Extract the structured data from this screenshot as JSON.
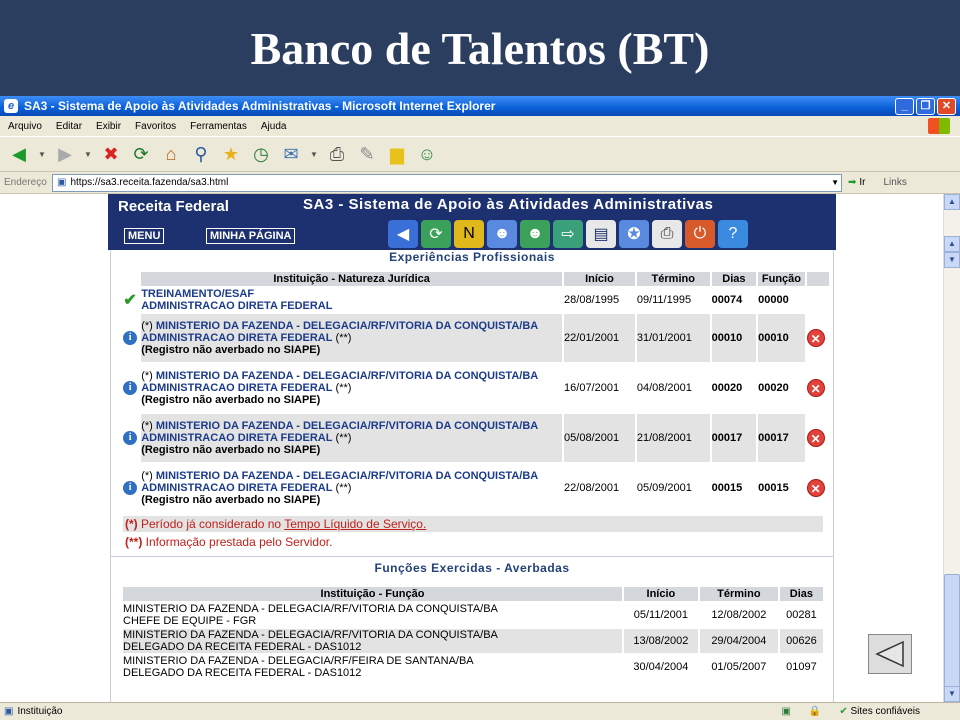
{
  "slide": {
    "title": "Banco de Talentos (BT)"
  },
  "window": {
    "title": "SA3 - Sistema de Apoio às Atividades Administrativas - Microsoft Internet Explorer"
  },
  "menu": [
    "Arquivo",
    "Editar",
    "Exibir",
    "Favoritos",
    "Ferramentas",
    "Ajuda"
  ],
  "address": {
    "label": "Endereço",
    "url": "https://sa3.receita.fazenda/sa3.html",
    "go": "Ir",
    "links": "Links"
  },
  "app": {
    "org": "Receita Federal",
    "system": "SA3 - Sistema de Apoio às Atividades Administrativas",
    "menu_label": "MENU",
    "my_page_label": "MINHA PÁGINA"
  },
  "exp": {
    "title": "Experiências Profissionais",
    "headers": [
      "Instituição - Natureza Jurídica",
      "Início",
      "Término",
      "Dias",
      "Função"
    ],
    "rows": [
      {
        "inst": "TREINAMENTO/ESAF",
        "nature": "ADMINISTRACAO DIRETA FEDERAL",
        "prefix": "",
        "nature_suffix": "",
        "note": "",
        "start": "28/08/1995",
        "end": "09/11/1995",
        "days": "00074",
        "func": "00000"
      },
      {
        "prefix": "(*) ",
        "inst": "MINISTERIO DA FAZENDA - DELEGACIA/RF/VITORIA DA CONQUISTA/BA",
        "nature": "ADMINISTRACAO DIRETA FEDERAL",
        "nature_suffix": " (**)",
        "note": "(Registro não averbado no SIAPE)",
        "start": "22/01/2001",
        "end": "31/01/2001",
        "days": "00010",
        "func": "00010"
      },
      {
        "prefix": "(*) ",
        "inst": "MINISTERIO DA FAZENDA - DELEGACIA/RF/VITORIA DA CONQUISTA/BA",
        "nature": "ADMINISTRACAO DIRETA FEDERAL",
        "nature_suffix": " (**)",
        "note": "(Registro não averbado no SIAPE)",
        "start": "16/07/2001",
        "end": "04/08/2001",
        "days": "00020",
        "func": "00020"
      },
      {
        "prefix": "(*) ",
        "inst": "MINISTERIO DA FAZENDA - DELEGACIA/RF/VITORIA DA CONQUISTA/BA",
        "nature": "ADMINISTRACAO DIRETA FEDERAL",
        "nature_suffix": " (**)",
        "note": "(Registro não averbado no SIAPE)",
        "start": "05/08/2001",
        "end": "21/08/2001",
        "days": "00017",
        "func": "00017"
      },
      {
        "prefix": "(*) ",
        "inst": "MINISTERIO DA FAZENDA - DELEGACIA/RF/VITORIA DA CONQUISTA/BA",
        "nature": "ADMINISTRACAO DIRETA FEDERAL",
        "nature_suffix": " (**)",
        "note": "(Registro não averbado no SIAPE)",
        "start": "22/08/2001",
        "end": "05/09/2001",
        "days": "00015",
        "func": "00015"
      }
    ],
    "legend1_mark": "(*)",
    "legend1_text": " Período já considerado no ",
    "legend1_link": "Tempo Líquido de Serviço.",
    "legend2_mark": "(**)",
    "legend2_text": " Informação prestada pelo Servidor."
  },
  "func": {
    "title": "Funções Exercidas - Averbadas",
    "headers": [
      "Instituição - Função",
      "Início",
      "Término",
      "Dias"
    ],
    "rows": [
      {
        "inst": "MINISTERIO DA FAZENDA - DELEGACIA/RF/VITORIA DA CONQUISTA/BA",
        "role": "CHEFE DE EQUIPE - FGR",
        "start": "05/11/2001",
        "end": "12/08/2002",
        "days": "00281"
      },
      {
        "inst": "MINISTERIO DA FAZENDA - DELEGACIA/RF/VITORIA DA CONQUISTA/BA",
        "role": "DELEGADO DA RECEITA FEDERAL - DAS1012",
        "start": "13/08/2002",
        "end": "29/04/2004",
        "days": "00626"
      },
      {
        "inst": "MINISTERIO DA FAZENDA - DELEGACIA/RF/FEIRA DE SANTANA/BA",
        "role": "DELEGADO DA RECEITA FEDERAL - DAS1012",
        "start": "30/04/2004",
        "end": "01/05/2007",
        "days": "01097"
      }
    ]
  },
  "status": {
    "left": "Instituição",
    "right": "Sites confiáveis"
  }
}
